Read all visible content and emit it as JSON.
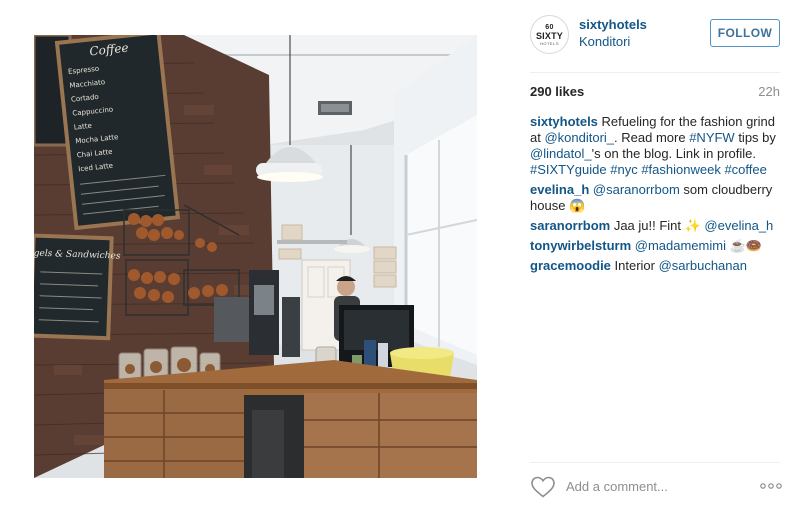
{
  "photo": {
    "menu_board_heading": "Coffee",
    "menu_board_items": [
      "Espresso",
      "Macchiato",
      "Cortado",
      "Cappuccino",
      "Latte",
      "Mocha Latte",
      "Chai Latte",
      "Iced Latte"
    ],
    "bagel_board_heading": "Bagels & Sandwiches"
  },
  "post": {
    "avatar": {
      "line1": "60",
      "line2": "SIXTY",
      "line3": "HOTELS"
    },
    "username": "sixtyhotels",
    "location": "Konditori",
    "follow_label": "FOLLOW",
    "likes": "290 likes",
    "time_ago": "22h"
  },
  "caption": {
    "user": "sixtyhotels",
    "t1": " Refueling for the fashion grind at ",
    "m1": "@konditori_",
    "t2": ". Read more ",
    "h1": "#NYFW",
    "t3": " tips by ",
    "m2": "@lindatol_",
    "t4": "'s on the blog. Link in profile. ",
    "h2": "#SIXTYguide",
    "t5": " ",
    "h3": "#nyc",
    "t6": " ",
    "h4": "#fashionweek",
    "t7": " ",
    "h5": "#coffee"
  },
  "comments": [
    {
      "user": "evelina_h",
      "pre": " ",
      "mention": "@saranorrbom",
      "post": " som cloudberry house 😱"
    },
    {
      "user": "saranorrbom",
      "pre": " Jaa ju!! Fint ✨  ",
      "mention": "@evelina_h",
      "post": ""
    },
    {
      "user": "tonywirbelsturm",
      "pre": " ",
      "mention": "@madamemimi",
      "post": " ☕🍩"
    },
    {
      "user": "gracemoodie",
      "pre": " Interior ",
      "mention": "@sarbuchanan",
      "post": ""
    }
  ],
  "footer": {
    "comment_placeholder": "Add a comment...",
    "icons": {
      "like": "heart-icon",
      "more": "more-options-icon"
    }
  },
  "colors": {
    "link": "#125688",
    "follow_border": "#4f93c8",
    "follow_text": "#3f729b",
    "muted": "#8e8e8e"
  }
}
